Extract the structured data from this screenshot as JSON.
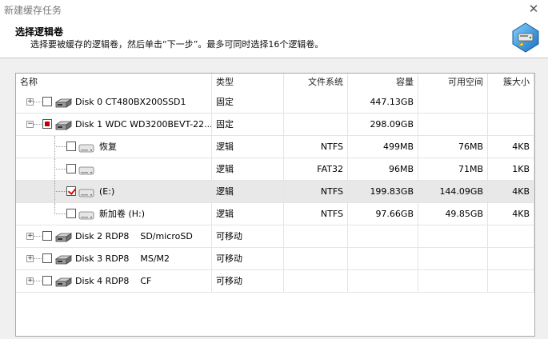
{
  "window": {
    "title": "新建缓存任务",
    "close_glyph": "✕"
  },
  "header": {
    "title": "选择逻辑卷",
    "subtitle": "选择要被缓存的逻辑卷，然后单击“下一步”。最多可同时选择16个逻辑卷。"
  },
  "table": {
    "columns": [
      "名称",
      "类型",
      "文件系统",
      "容量",
      "可用空间",
      "簇大小"
    ],
    "rows": [
      {
        "name": "Disk 0 CT480BX200SSD1",
        "type": "固定",
        "fs": "",
        "capacity": "447.13GB",
        "free": "",
        "cluster": "",
        "level": 0,
        "checkbox": "unchecked",
        "expander": "+"
      },
      {
        "name": "Disk 1 WDC WD3200BEVT-22...",
        "type": "固定",
        "fs": "",
        "capacity": "298.09GB",
        "free": "",
        "cluster": "",
        "level": 0,
        "checkbox": "partial",
        "expander": "-"
      },
      {
        "name": "恢复",
        "type": "逻辑",
        "fs": "NTFS",
        "capacity": "499MB",
        "free": "76MB",
        "cluster": "4KB",
        "level": 1,
        "checkbox": "unchecked"
      },
      {
        "name": "",
        "type": "逻辑",
        "fs": "FAT32",
        "capacity": "96MB",
        "free": "71MB",
        "cluster": "1KB",
        "level": 1,
        "checkbox": "unchecked"
      },
      {
        "name": "(E:)",
        "type": "逻辑",
        "fs": "NTFS",
        "capacity": "199.83GB",
        "free": "144.09GB",
        "cluster": "4KB",
        "level": 1,
        "checkbox": "checked",
        "selected": true
      },
      {
        "name": "新加卷 (H:)",
        "type": "逻辑",
        "fs": "NTFS",
        "capacity": "97.66GB",
        "free": "49.85GB",
        "cluster": "4KB",
        "level": 1,
        "checkbox": "unchecked"
      },
      {
        "name": "Disk 2 RDP8    SD/microSD",
        "type": "可移动",
        "fs": "",
        "capacity": "",
        "free": "",
        "cluster": "",
        "level": 0,
        "checkbox": "unchecked",
        "expander": "+"
      },
      {
        "name": "Disk 3 RDP8    MS/M2",
        "type": "可移动",
        "fs": "",
        "capacity": "",
        "free": "",
        "cluster": "",
        "level": 0,
        "checkbox": "unchecked",
        "expander": "+"
      },
      {
        "name": "Disk 4 RDP8    CF",
        "type": "可移动",
        "fs": "",
        "capacity": "",
        "free": "",
        "cluster": "",
        "level": 0,
        "checkbox": "unchecked",
        "expander": "+"
      }
    ]
  },
  "icons": {
    "disk": "hard-disk-icon",
    "volume": "volume-drive-icon",
    "wizard": "wizard-disk-icon"
  },
  "colors": {
    "check": "#d01010",
    "selected_row": "#e8e8e8"
  }
}
